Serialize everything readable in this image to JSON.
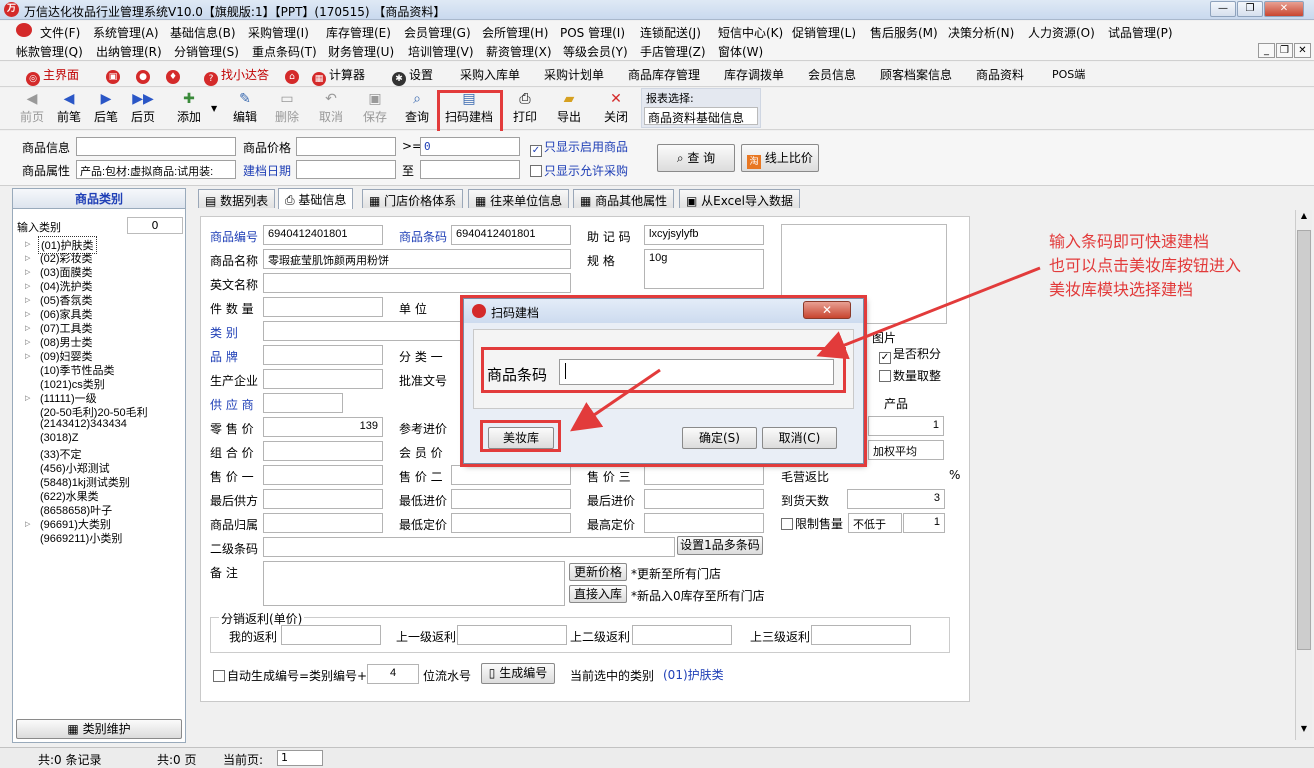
{
  "window": {
    "title": "万信达化妆品行业管理系统V10.0【旗舰版:1】【PPT】(170515) 【商品资料】",
    "logo_text": "万",
    "controls": {
      "minimize": "—",
      "restore": "❐",
      "close": "✕"
    }
  },
  "menu": {
    "row1": [
      "文件(F)",
      "系统管理(A)",
      "基础信息(B)",
      "采购管理(I)",
      "库存管理(E)",
      "会员管理(G)",
      "会所管理(H)",
      "POS 管理(I)",
      "连锁配送(J)",
      "短信中心(K)",
      "促销管理(L)",
      "售后服务(M)",
      "决策分析(N)",
      "人力资源(O)",
      "试品管理(P)"
    ],
    "row2": [
      "帐款管理(Q)",
      "出纳管理(R)",
      "分销管理(S)",
      "重点条码(T)",
      "财务管理(U)",
      "培训管理(V)",
      "薪资管理(X)",
      "等级会员(Y)",
      "手店管理(Z)",
      "窗体(W)"
    ]
  },
  "quickbar": {
    "items": [
      "主界面",
      "找小达答",
      "计算器",
      "设置",
      "采购入库单",
      "采购计划单",
      "商品库存管理",
      "库存调拨单",
      "会员信息",
      "顾客档案信息",
      "商品资料",
      "POS端"
    ]
  },
  "toolbar": {
    "buttons": [
      "前页",
      "前笔",
      "后笔",
      "后页",
      "添加",
      "编辑",
      "删除",
      "取消",
      "保存",
      "查询",
      "扫码建档",
      "打印",
      "导出",
      "关闭"
    ],
    "report_label": "报表选择:",
    "report_value": "商品资料基础信息"
  },
  "filter": {
    "product_info_label": "商品信息",
    "product_price_label": "商品价格",
    "gte_label": ">=",
    "gte_value": "0",
    "only_enabled_label": "只显示启用商品",
    "product_attr_label": "商品属性",
    "product_attr_value": "产品:包材:虚拟商品:试用装:",
    "create_date_label": "建档日期",
    "to_label": "至",
    "only_allow_purchase_label": "只显示允许采购",
    "query_button": "查 询",
    "online_compare_button": "线上比价"
  },
  "category_panel": {
    "title": "商品类别",
    "input_label": "输入类别",
    "input_value": "0",
    "items": [
      "(01)护肤类",
      "(02)彩妆类",
      "(03)面膜类",
      "(04)洗护类",
      "(05)香氛类",
      "(06)家具类",
      "(07)工具类",
      "(08)男士类",
      "(09)妇婴类",
      "(10)季节性品类",
      "(1021)cs类别",
      "(11111)一级",
      "(20-50毛利)20-50毛利",
      "(2143412)343434",
      "(3018)Z",
      "(33)不定",
      "(456)小郑测试",
      "(5848)1kj测试类别",
      "(622)水果类",
      "(8658658)叶子",
      "(96691)大类别",
      "(9669211)小类别"
    ],
    "maintain_button": "类别维护"
  },
  "tabs": [
    "数据列表",
    "基础信息",
    "门店价格体系",
    "往来单位信息",
    "商品其他属性",
    "从Excel导入数据"
  ],
  "form": {
    "code_label": "商品编号",
    "code_value": "6940412401801",
    "barcode_label": "商品条码",
    "barcode_value": "6940412401801",
    "mnemonic_label": "助 记 码",
    "mnemonic_value": "lxcyjsylyfb",
    "name_label": "商品名称",
    "name_value": "零瑕疵莹肌饰颜两用粉饼",
    "spec_label": "规   格",
    "spec_value": "10g",
    "en_name_label": "英文名称",
    "qty_label": "件 数 量",
    "unit_label": "单   位",
    "category_label": "类   别",
    "brand_label": "品   牌",
    "class1_label": "分 类 一",
    "maker_label": "生产企业",
    "approval_label": "批准文号",
    "supplier_label": "供 应 商",
    "retail_label": "零 售 价",
    "retail_value": "139",
    "ref_price_label": "参考进价",
    "combo_label": "组 合 价",
    "member_label": "会 员 价",
    "price1_label": "售 价 一",
    "price2_label": "售 价 二",
    "price3_label": "售 价 三",
    "last_supplier_label": "最后供方",
    "min_purchase_label": "最低进价",
    "last_purchase_label": "最后进价",
    "arrival_label": "到货天数",
    "arrival_value": "3",
    "belong_label": "商品归属",
    "min_price_label": "最低定价",
    "max_price_label": "最高定价",
    "limit_label": "限制售量",
    "limit_option": "不低于",
    "limit_value": "1",
    "secondary_barcode_label": "二级条码",
    "multi_barcode_button": "设置1品多条码",
    "remark_label": "备   注",
    "update_price_button": "更新价格",
    "update_price_note": "*更新至所有门店",
    "direct_stock_button": "直接入库",
    "direct_stock_note": "*新品入0库存至所有门店",
    "rebate_group": "分销返利(单价)",
    "my_rebate_label": "我的返利",
    "up1_label": "上一级返利",
    "up2_label": "上二级返利",
    "up3_label": "上三级返利",
    "auto_gen_label": "自动生成编号=类别编号+",
    "auto_gen_value": "4",
    "serial_label": "位流水号",
    "gen_button": "生成编号",
    "current_cat_label": "当前选中的类别",
    "current_cat_value": "(01)护肤类",
    "picture_label": "图片",
    "points_label": "是否积分",
    "qty_points_label": "数量取整",
    "product_label": "产品",
    "cost_value": "1",
    "weighted_label": "加权平均",
    "margin_label": "毛营返比",
    "percent_label": "%",
    "fields": {
      "v1": "1"
    }
  },
  "dialog": {
    "title": "扫码建档",
    "barcode_label": "商品条码",
    "barcode_value": "",
    "beauty_lib_button": "美妆库",
    "ok_button": "确定(S)",
    "cancel_button": "取消(C)"
  },
  "annotation": {
    "line1": "输入条码即可快速建档",
    "line2": "也可以点击美妆库按钮进入",
    "line3": "美妆库模块选择建档"
  },
  "status": {
    "records": "共:0 条记录",
    "pages": "共:0 页",
    "current_page_label": "当前页:",
    "current_page_value": "1"
  },
  "colors": {
    "highlight": "#e23b3b",
    "link_blue": "#1f3fb6",
    "panel_title": "#1f3fb6"
  }
}
